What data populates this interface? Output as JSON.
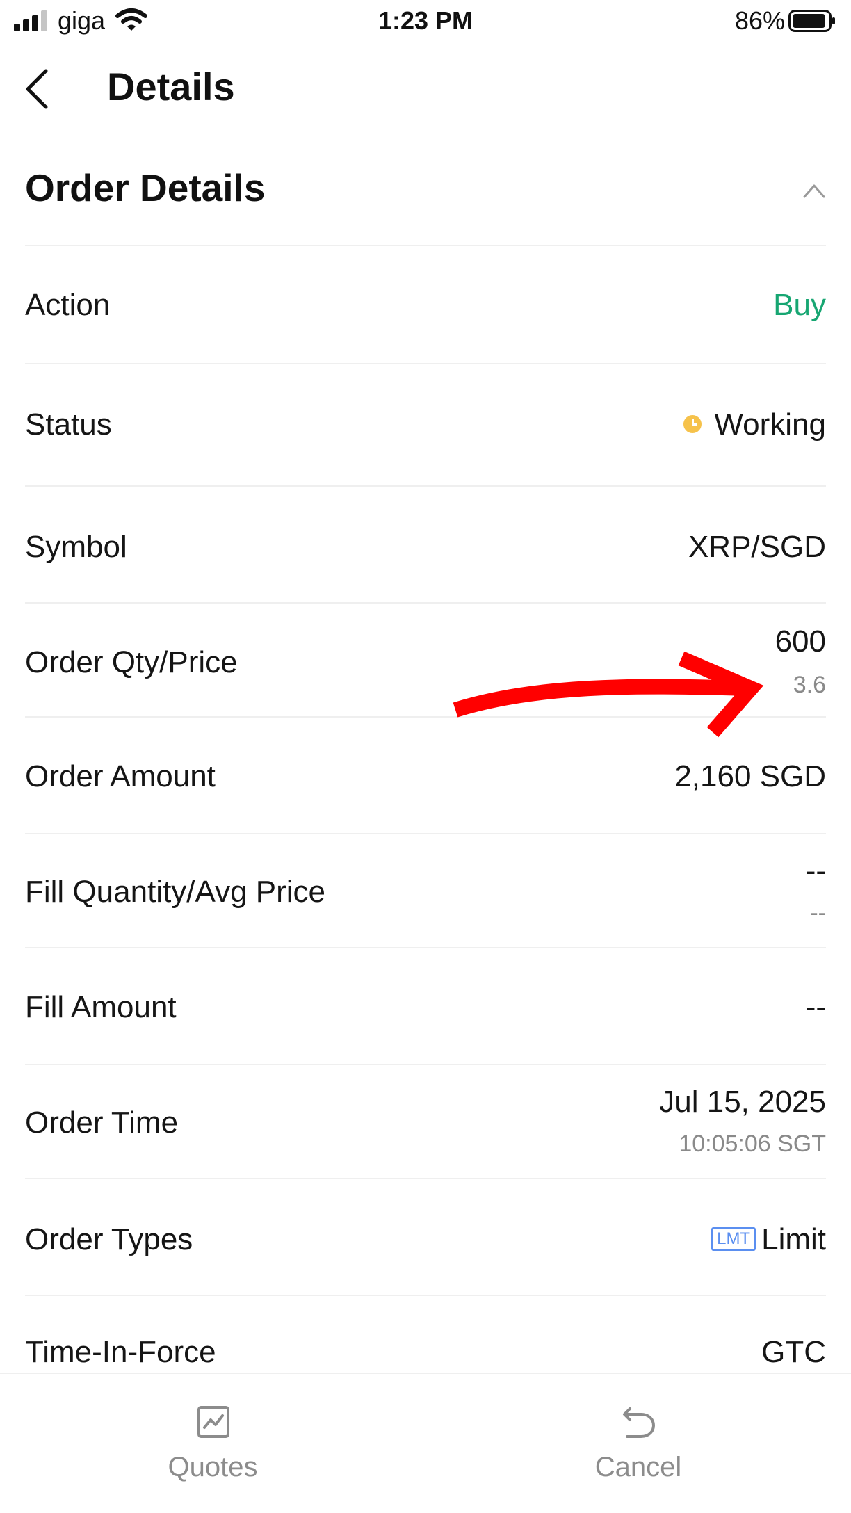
{
  "status_bar": {
    "carrier": "giga",
    "time": "1:23 PM",
    "battery": "86%",
    "icons": [
      "signal-icon",
      "wifi-icon",
      "battery-icon"
    ]
  },
  "nav": {
    "title": "Details",
    "back_icon": "chevron-left-icon"
  },
  "section": {
    "title": "Order Details",
    "toggle_icon": "chevron-up-icon"
  },
  "rows": {
    "action": {
      "label": "Action",
      "value": "Buy"
    },
    "status": {
      "label": "Status",
      "value": "Working",
      "icon": "clock-icon"
    },
    "symbol": {
      "label": "Symbol",
      "value": "XRP/SGD"
    },
    "qty_price": {
      "label": "Order Qty/Price",
      "value": "600",
      "sub": "3.6"
    },
    "amount": {
      "label": "Order Amount",
      "value": "2,160 SGD"
    },
    "fill_qty": {
      "label": "Fill Quantity/Avg Price",
      "value": "--",
      "sub": "--"
    },
    "fill_amount": {
      "label": "Fill Amount",
      "value": "--"
    },
    "order_time": {
      "label": "Order Time",
      "value": "Jul 15, 2025",
      "sub": "10:05:06 SGT"
    },
    "order_types": {
      "label": "Order Types",
      "badge": "LMT",
      "value": "Limit"
    },
    "tif": {
      "label": "Time-In-Force",
      "value": "GTC"
    }
  },
  "tab_bar": {
    "quotes": {
      "label": "Quotes",
      "icon": "chart-icon"
    },
    "cancel": {
      "label": "Cancel",
      "icon": "undo-icon"
    }
  },
  "colors": {
    "buy": "#17a672",
    "status_working": "#f6c24b",
    "badge": "#5b8ff0",
    "annotation": "#ff0000"
  }
}
